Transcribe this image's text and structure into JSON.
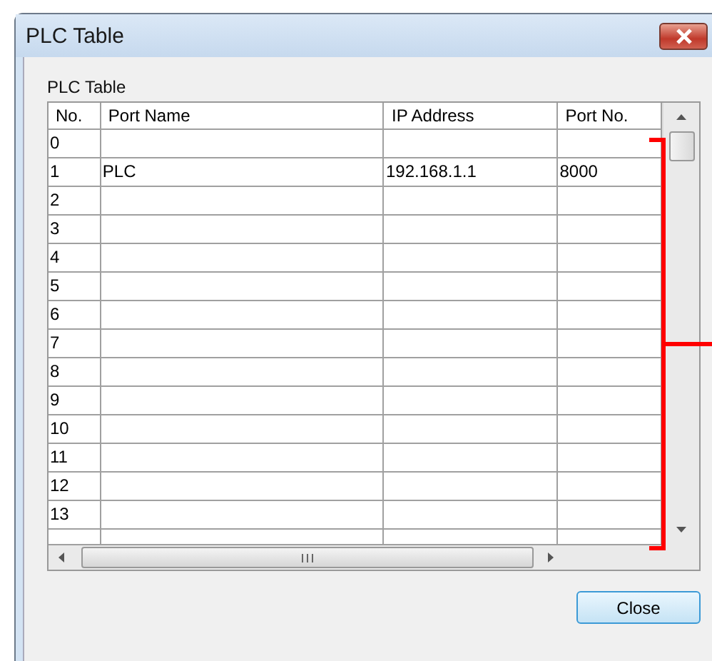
{
  "window": {
    "title": "PLC Table"
  },
  "group_label": "PLC Table",
  "table": {
    "columns": [
      "No.",
      "Port Name",
      "IP Address",
      "Port No."
    ],
    "rows": [
      [
        "0",
        "",
        "",
        ""
      ],
      [
        "1",
        "PLC",
        "192.168.1.1",
        "8000"
      ],
      [
        "2",
        "",
        "",
        ""
      ],
      [
        "3",
        "",
        "",
        ""
      ],
      [
        "4",
        "",
        "",
        ""
      ],
      [
        "5",
        "",
        "",
        ""
      ],
      [
        "6",
        "",
        "",
        ""
      ],
      [
        "7",
        "",
        "",
        ""
      ],
      [
        "8",
        "",
        "",
        ""
      ],
      [
        "9",
        "",
        "",
        ""
      ],
      [
        "10",
        "",
        "",
        ""
      ],
      [
        "11",
        "",
        "",
        ""
      ],
      [
        "12",
        "",
        "",
        ""
      ],
      [
        "13",
        "",
        "",
        ""
      ]
    ]
  },
  "buttons": [
    "Close"
  ]
}
